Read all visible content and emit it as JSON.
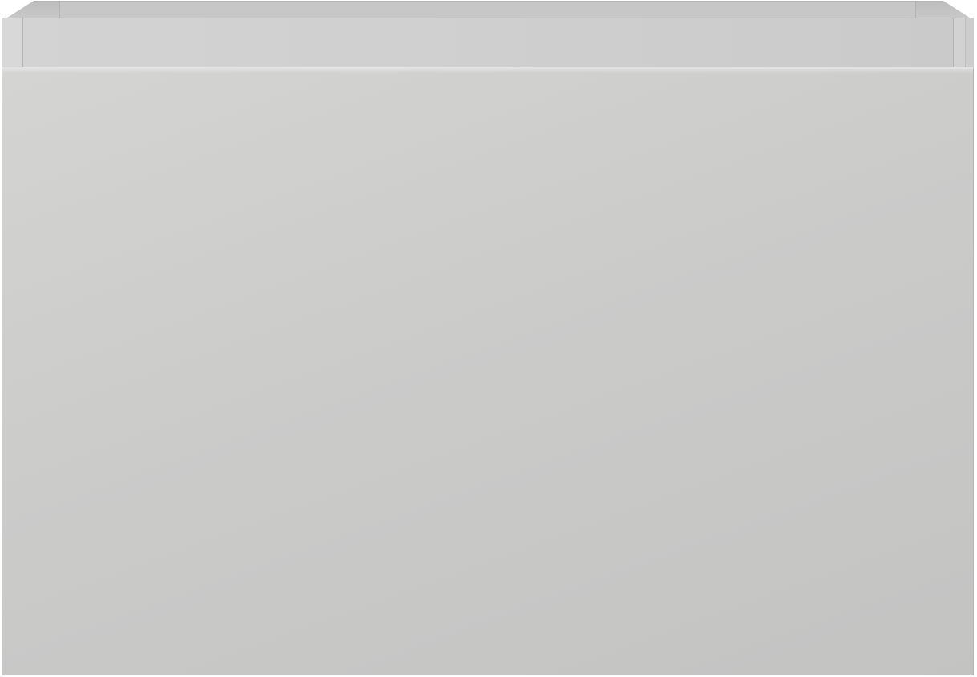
{
  "scene": {
    "subject": "open-top-box",
    "colors": {
      "panel": "#cbcbca",
      "rim": "#cfcfcf",
      "edge": "#b6b6b6",
      "background": "#ffffff"
    }
  }
}
